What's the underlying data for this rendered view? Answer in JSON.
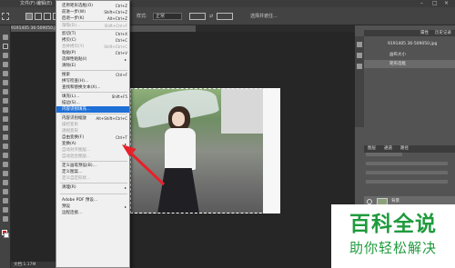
{
  "menubar": {
    "items": [
      {
        "label": "文件(F)"
      },
      {
        "label": "编辑(E)"
      }
    ]
  },
  "optionbar": {
    "style_label": "样式:",
    "style_value": "正常",
    "select_subject": "选择并遮住..."
  },
  "document": {
    "tab_title": "9191405 36-509050.jpg @ 66.7%(RGB/8#)"
  },
  "edit_menu": {
    "items": [
      {
        "label": "还原矩形选框(O)",
        "shortcut": "Ctrl+Z",
        "disabled": false
      },
      {
        "label": "前进一步(W)",
        "shortcut": "Shift+Ctrl+Z",
        "disabled": false
      },
      {
        "label": "后退一步(K)",
        "shortcut": "Alt+Ctrl+Z",
        "disabled": false
      },
      {
        "label": "渐隐(D)...",
        "shortcut": "Shift+Ctrl+F",
        "disabled": true
      },
      {
        "label": "剪切(T)",
        "shortcut": "Ctrl+X",
        "disabled": false
      },
      {
        "label": "拷贝(C)",
        "shortcut": "Ctrl+C",
        "disabled": false
      },
      {
        "label": "合并拷贝(Y)",
        "shortcut": "Shift+Ctrl+C",
        "disabled": true
      },
      {
        "label": "粘贴(P)",
        "shortcut": "Ctrl+V",
        "disabled": false
      },
      {
        "label": "选择性粘贴(I)",
        "shortcut": "",
        "disabled": false,
        "submenu": true
      },
      {
        "label": "清除(E)",
        "shortcut": "",
        "disabled": false
      },
      {
        "label": "搜索",
        "shortcut": "Ctrl+F",
        "disabled": false
      },
      {
        "label": "拼写检查(H)...",
        "shortcut": "",
        "disabled": false
      },
      {
        "label": "查找和替换文本(X)...",
        "shortcut": "",
        "disabled": false
      },
      {
        "label": "填充(L)...",
        "shortcut": "Shift+F5",
        "disabled": false
      },
      {
        "label": "描边(S)...",
        "shortcut": "",
        "disabled": false
      },
      {
        "label": "内容识别填充...",
        "shortcut": "",
        "disabled": false,
        "highlighted": true
      },
      {
        "label": "内容识别缩放",
        "shortcut": "Alt+Shift+Ctrl+C",
        "disabled": false
      },
      {
        "label": "操控变形",
        "shortcut": "",
        "disabled": true
      },
      {
        "label": "透视变形",
        "shortcut": "",
        "disabled": true
      },
      {
        "label": "自由变换(F)",
        "shortcut": "Ctrl+T",
        "disabled": false
      },
      {
        "label": "变换(A)",
        "shortcut": "",
        "disabled": false,
        "submenu": true
      },
      {
        "label": "自动对齐图层...",
        "shortcut": "",
        "disabled": true
      },
      {
        "label": "自动混合图层...",
        "shortcut": "",
        "disabled": true
      },
      {
        "label": "定义画笔预设(B)...",
        "shortcut": "",
        "disabled": false
      },
      {
        "label": "定义图案...",
        "shortcut": "",
        "disabled": false
      },
      {
        "label": "定义自定形状...",
        "shortcut": "",
        "disabled": true
      },
      {
        "label": "清理(R)",
        "shortcut": "",
        "disabled": false,
        "submenu": true
      },
      {
        "label": "Adobe PDF 预设...",
        "shortcut": "",
        "disabled": false
      },
      {
        "label": "预设",
        "shortcut": "",
        "disabled": false,
        "submenu": true
      },
      {
        "label": "远程连接...",
        "shortcut": "",
        "disabled": false
      }
    ]
  },
  "history_panel": {
    "tabs": [
      "属性",
      "历史记录"
    ],
    "rows": [
      {
        "label": "9191405 36-509050.jpg"
      },
      {
        "label": "画布大小"
      },
      {
        "label": "矩形选框"
      }
    ]
  },
  "layers_panel": {
    "tabs": [
      "图层",
      "通道",
      "路径"
    ],
    "layer_name": "背景"
  },
  "status": {
    "text": "文档:1.17M"
  },
  "watermark": {
    "title": "百科全说",
    "subtitle": "助你轻松解决"
  },
  "colors": {
    "highlight": "#1e6fd6",
    "arrow": "#e8202a",
    "watermark": "#1f9b3d"
  }
}
